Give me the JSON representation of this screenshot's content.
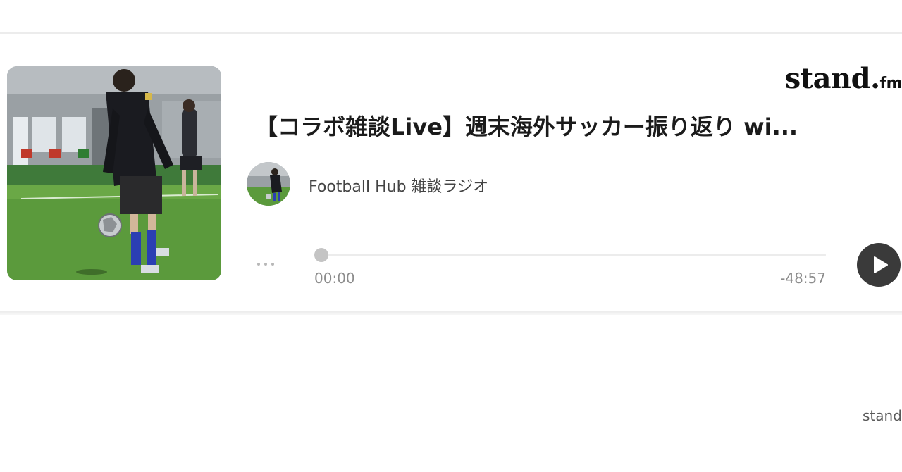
{
  "brand": {
    "logo_main": "stand.",
    "logo_suffix": "fm"
  },
  "episode": {
    "title": "【コラボ雑談Live】週末海外サッカー振り返り wi...",
    "artwork_icon": "episode-artwork"
  },
  "channel": {
    "name": "Football Hub 雑談ラジオ",
    "avatar_icon": "channel-avatar"
  },
  "player": {
    "more_icon": "more-horizontal-icon",
    "current_time": "00:00",
    "remaining_time": "-48:57",
    "progress": 0.0,
    "play_icon": "play-icon"
  },
  "footer": {
    "link_text": "stand"
  },
  "colors": {
    "play_button": "#3a3a3a",
    "title": "#1b1b1b",
    "time": "#8c8c8c",
    "track": "#ececec",
    "knob": "#c4c4c4"
  }
}
